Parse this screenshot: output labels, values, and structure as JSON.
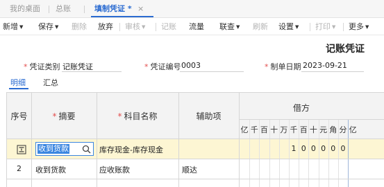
{
  "tabs": [
    {
      "label": "我的桌面"
    },
    {
      "label": "总账"
    },
    {
      "label": "填制凭证 *"
    }
  ],
  "tab_close": "×",
  "toolbar": {
    "new": "新增",
    "save": "保存",
    "delete": "删除",
    "abandon": "放弃",
    "audit": "审核",
    "post": "记账",
    "flow": "流量",
    "query": "联查",
    "refresh": "刷新",
    "settings": "设置",
    "print": "打印",
    "more": "更多"
  },
  "voucher": {
    "title": "记账凭证",
    "type_label": "凭证类别",
    "type_value": "记账凭证",
    "number_label": "凭证编号",
    "number_value": "0003",
    "date_label": "制单日期",
    "date_value": "2023-09-21"
  },
  "subtabs": {
    "detail": "明细",
    "summary": "汇总"
  },
  "grid": {
    "headers": {
      "seq": "序号",
      "summary": "摘要",
      "account": "科目名称",
      "aux": "辅助项",
      "debit": "借方"
    },
    "digit_headers": [
      "亿",
      "千",
      "百",
      "十",
      "万",
      "千",
      "百",
      "十",
      "元",
      "角",
      "分",
      "亿"
    ],
    "rows": [
      {
        "summary": "收到货款",
        "account": "库存现金-库存现金",
        "aux": "",
        "debit_digits": [
          "",
          "",
          "",
          "",
          "",
          "1",
          "0",
          "0",
          "0",
          "0",
          "0",
          ""
        ]
      },
      {
        "seq": "2",
        "summary": "收到货款",
        "account": "应收账款",
        "aux": "顺达"
      }
    ]
  },
  "colors": {
    "accent": "#2a6bd1",
    "required": "#e34d4d",
    "active_row": "#fdf6d3"
  }
}
